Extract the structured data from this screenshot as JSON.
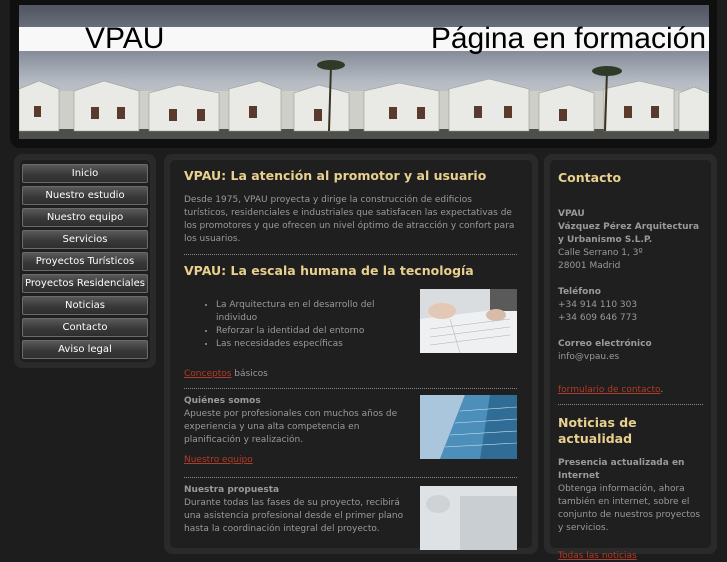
{
  "header": {
    "title_left": "VPAU",
    "title_right": "Página en formación"
  },
  "nav": {
    "items": [
      {
        "label": "Inicio"
      },
      {
        "label": "Nuestro estudio"
      },
      {
        "label": "Nuestro equipo"
      },
      {
        "label": "Servicios"
      },
      {
        "label": "Proyectos Turísticos"
      },
      {
        "label": "Proyectos Residenciales"
      },
      {
        "label": "Noticias"
      },
      {
        "label": "Contacto"
      },
      {
        "label": "Aviso legal"
      }
    ]
  },
  "main": {
    "section1": {
      "title": "VPAU: La atención al promotor y al usuario",
      "text": "Desde 1975, VPAU proyecta y dirige la construcción de edificios turísticos, residenciales e industriales que satisfacen las expectativas de los promotores y que ofrecen un nivel óptimo de atracción y confort para los usuarios."
    },
    "section2": {
      "title": "VPAU: La escala humana de la tecnología",
      "bullets": [
        "La Arquitectura en el desarrollo del individuo",
        "Reforzar la identidad del entorno",
        "Las necesidades específicas"
      ],
      "link_text": "Conceptos",
      "link_suffix": " básicos"
    },
    "who": {
      "title": "Quiénes somos",
      "text": "Apueste por profesionales con muchos años de experiencia y una alta competencia en planificación y realización.",
      "link_text": "Nuestro equipo"
    },
    "proposal": {
      "title": "Nuestra propuesta",
      "text": "Durante todas las fases de su proyecto, recibirá una asistencia profesional desde el primer plano hasta la coordinación integral del proyecto."
    }
  },
  "sidebar": {
    "contact_title": "Contacto",
    "company_short": "VPAU",
    "company_full": "Vázquez Pérez Arquitectura y Urbanismo S.L.P.",
    "address_line1": "Calle Serrano 1, 3º",
    "address_line2": "28001 Madrid",
    "phone_label": "Teléfono",
    "phone1": "+34 914 110 303",
    "phone2": "+34 609 646 773",
    "email_label": "Correo electrónico",
    "email": "info@vpau.es",
    "form_link": "formulario de contacto",
    "form_suffix": ".",
    "news_title": "Noticias de actualidad",
    "news_item_title": "Presencia actualizada en Internet",
    "news_item_text": "Obtenga información, ahora también en internet, sobre el conjunto de nuestros proyectos y servicios.",
    "news_link": "Todas las noticias"
  }
}
